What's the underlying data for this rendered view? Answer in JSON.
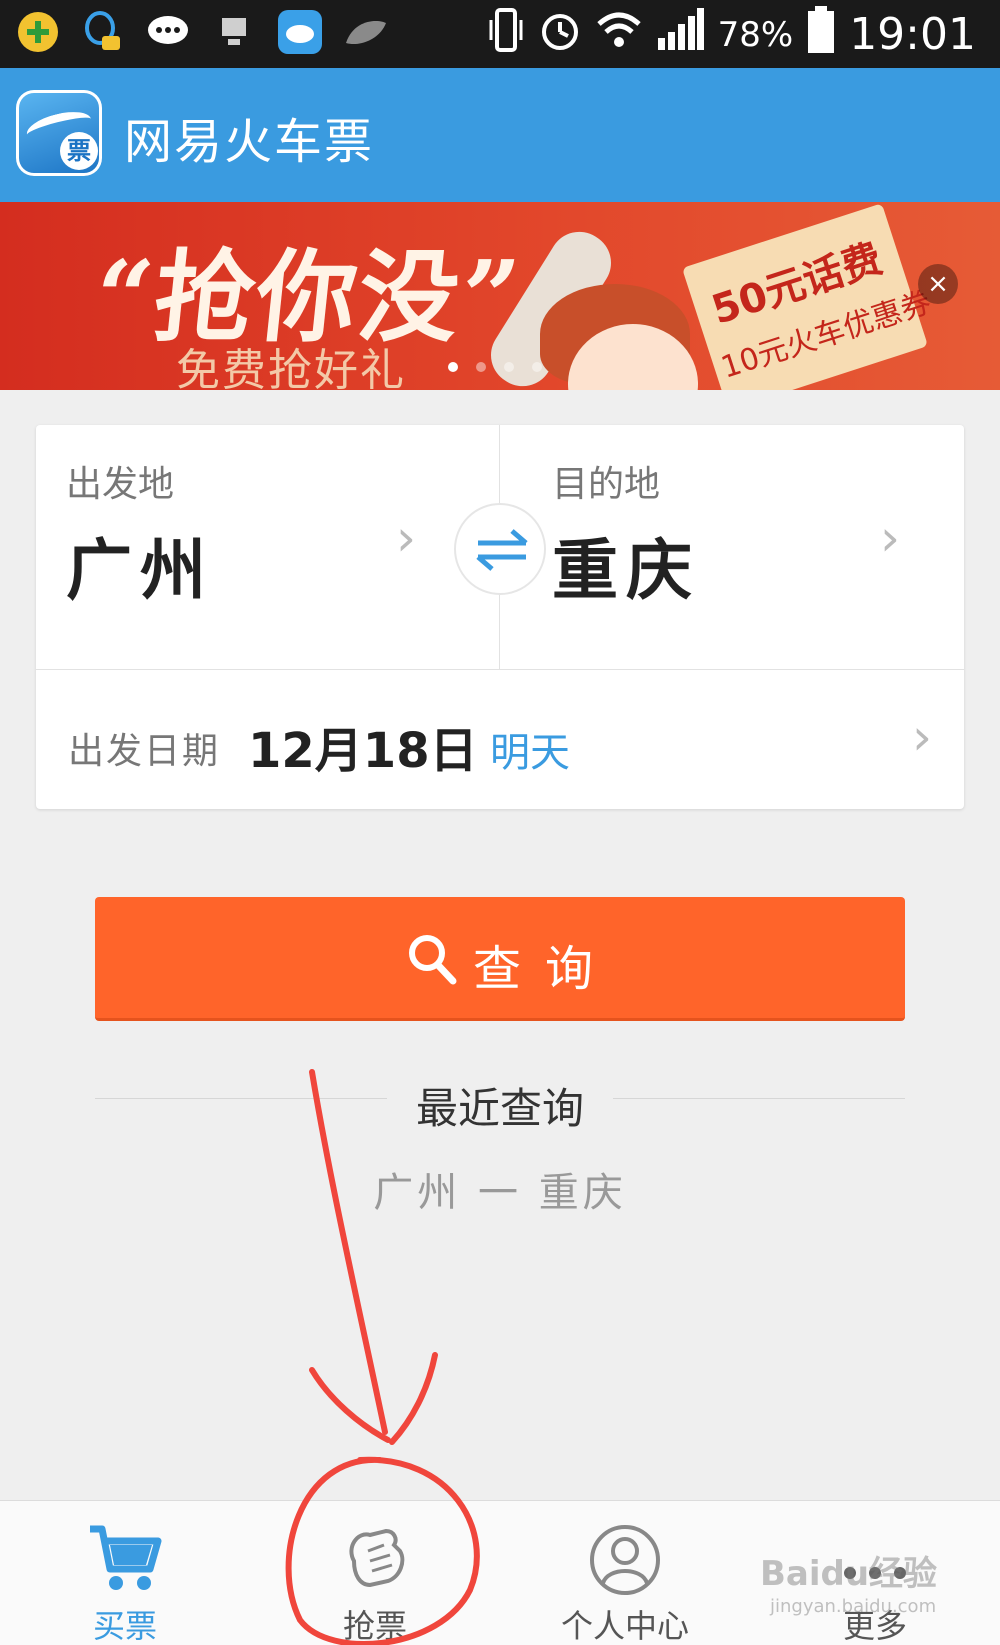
{
  "status_bar": {
    "battery": "78%",
    "time": "19:01",
    "left_icons": [
      "plus-shield-icon",
      "qq-chat-icon",
      "message-bubble-icon",
      "computer-icon",
      "cloud-icon",
      "leaf-icon"
    ],
    "right_icons": [
      "vibrate-icon",
      "alarm-icon",
      "wifi-icon",
      "signal-icon",
      "battery-icon"
    ]
  },
  "app_bar": {
    "title": "网易火车票",
    "logo_char": "票"
  },
  "banner": {
    "headline": "“抢你没”",
    "subline": "免费抢好礼",
    "tag_line1": "50元话费",
    "tag_line2": "10元火车优惠券",
    "close": "×",
    "page_count": 4,
    "active_page": 0
  },
  "search": {
    "from_label": "出发地",
    "from_city": "广州",
    "to_label": "目的地",
    "to_city": "重庆",
    "date_label": "出发日期",
    "date_value": "12月18日",
    "date_day": "明天",
    "chevron": "›"
  },
  "query_button": {
    "label": "查询"
  },
  "recent": {
    "title": "最近查询",
    "items": [
      "广州 一 重庆"
    ]
  },
  "bottom_nav": {
    "items": [
      {
        "label": "买票",
        "icon": "cart-icon",
        "active": true
      },
      {
        "label": "抢票",
        "icon": "grab-hand-icon",
        "active": false
      },
      {
        "label": "个人中心",
        "icon": "person-icon",
        "active": false
      },
      {
        "label": "更多",
        "icon": "more-dots-icon",
        "active": false
      }
    ]
  },
  "watermark": {
    "text": "Baidu经验",
    "sub": "jingyan.baidu.com"
  },
  "colors": {
    "app_bar": "#3a9be0",
    "banner": "#d42d1f",
    "query_button": "#ff642a",
    "accent": "#3a9be0",
    "annotation": "#f0463c"
  }
}
